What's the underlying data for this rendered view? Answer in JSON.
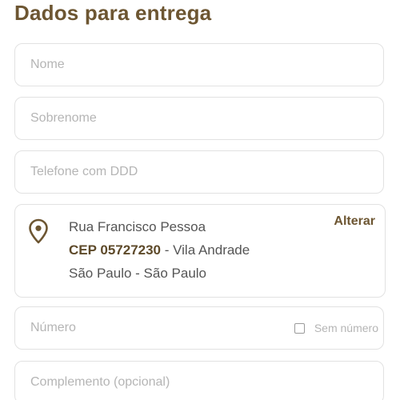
{
  "page": {
    "title": "Dados para entrega"
  },
  "fields": {
    "nome": {
      "placeholder": "Nome",
      "value": ""
    },
    "sobrenome": {
      "placeholder": "Sobrenome",
      "value": ""
    },
    "telefone": {
      "placeholder": "Telefone com DDD",
      "value": ""
    },
    "numero": {
      "placeholder": "Número",
      "value": ""
    },
    "complemento": {
      "placeholder": "Complemento (opcional)",
      "value": ""
    }
  },
  "address": {
    "street": "Rua Francisco Pessoa",
    "cep_label": "CEP 05727230",
    "neighborhood": " - Vila Andrade",
    "city_state": "São Paulo - São Paulo",
    "change_label": "Alterar",
    "icon": "map-pin-icon"
  },
  "sem_numero": {
    "label": "Sem número",
    "checked": false
  },
  "colors": {
    "accent": "#6d5632",
    "border": "#e2e2e2",
    "placeholder": "#b5b5b5",
    "text": "#555555"
  }
}
